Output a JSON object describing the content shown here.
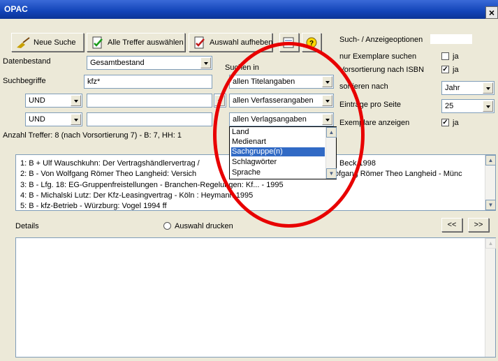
{
  "window": {
    "title": "OPAC",
    "close_glyph": "×"
  },
  "toolbar": {
    "new_search": "Neue Suche",
    "select_all": "Alle Treffer auswählen",
    "clear_selection": "Auswahl aufheben"
  },
  "options": {
    "heading": "Such- / Anzeigeoptionen",
    "only_copies": "nur Exemplare suchen",
    "only_copies_check": "ja",
    "presort_isbn": "Vorsortierung nach ISBN",
    "presort_isbn_check": "ja",
    "sort_by": "sortieren nach",
    "sort_value": "Jahr",
    "per_page": "Einträge pro Seite",
    "per_page_value": "25",
    "show_copies": "Exemplare anzeigen",
    "show_copies_check": "ja"
  },
  "form": {
    "datenbestand_label": "Datenbestand",
    "datenbestand_value": "Gesamtbestand",
    "suchbegriffe_label": "Suchbegriffe",
    "term1": "kfz*",
    "op2": "UND",
    "op3": "UND",
    "search_in_label": "Suchen in",
    "field1": "allen Titelangaben",
    "field2": "allen Verfasserangaben",
    "field3": "allen Verlagsangaben"
  },
  "dropdown_options": [
    "Land",
    "Medienart",
    "Sachgruppe(n)",
    "Schlagwörter",
    "Sprache"
  ],
  "dropdown_selected": "Sachgruppe(n)",
  "hits_summary": "Anzahl Treffer: 8 (nach Vorsortierung 7) - B: 7, HH: 1",
  "results": [
    {
      "left": "1: B + Ulf Wauschkuhn: Der Vertragshändlervertrag / ",
      "right": "Beck 1998"
    },
    {
      "left": "2: B - Von Wolfgang Römer  Theo Langheid: Versich",
      "right": "ofgang Römer  Theo Langheid - Münc"
    },
    {
      "left": "3: B - Lfg. 18: EG-Gruppenfreistellungen - Branchen-Regelungen: Kf... - 1995",
      "right": ""
    },
    {
      "left": "4: B - Michalski Lutz: Der Kfz-Leasingvertrag - Köln : Heymann 1995",
      "right": ""
    },
    {
      "left": "5: B - kfz-Betrieb - Würzburg: Vogel 1994 ff",
      "right": ""
    }
  ],
  "details": {
    "label": "Details",
    "print_selection": "Auswahl drucken",
    "prev": "<<",
    "next": ">>"
  },
  "colors": {
    "titlebar": "#0a246a",
    "selection": "#316ac5",
    "annotation": "#e80000"
  }
}
